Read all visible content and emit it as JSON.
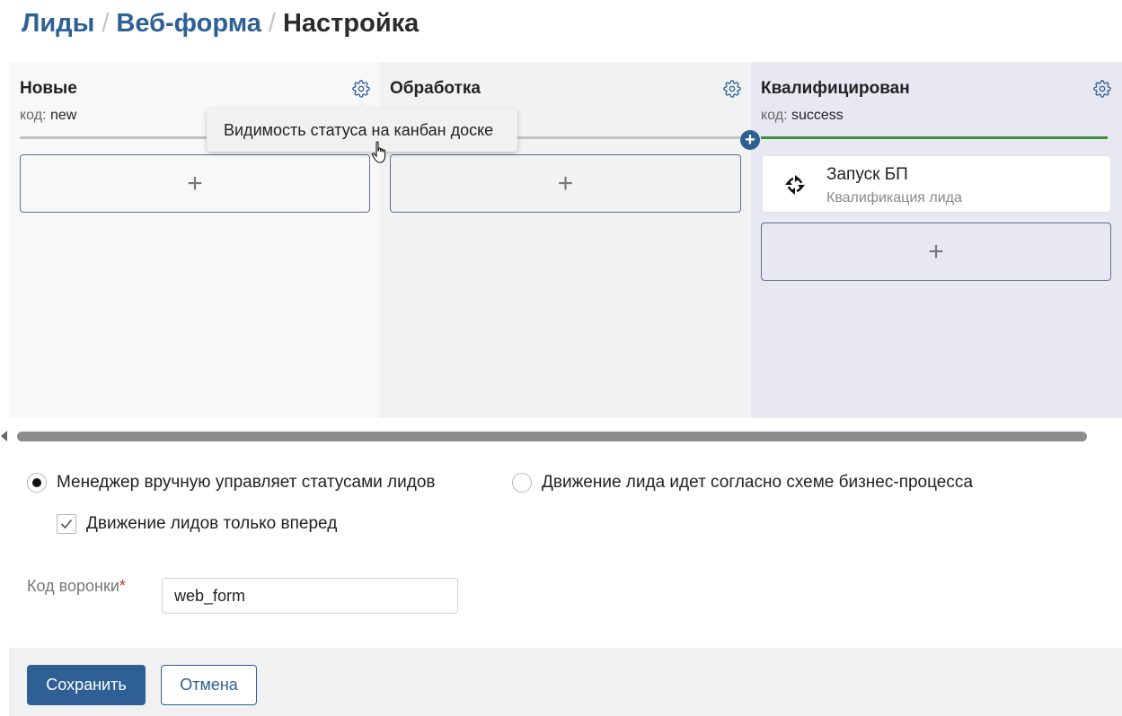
{
  "breadcrumb": {
    "items": [
      "Лиды",
      "Веб-форма"
    ],
    "current": "Настройка",
    "separator": "/"
  },
  "columns": [
    {
      "title": "Новые",
      "code_label": "код:",
      "code": "new",
      "add_label": "+",
      "background": "#f8f8f8",
      "line_color": "#c3c3c3"
    },
    {
      "title": "Обработка",
      "code_label": "код:",
      "code": "",
      "add_label": "+",
      "background": "#f2f2f2",
      "line_color": "#c3c3c3"
    },
    {
      "title": "Квалифицирован",
      "code_label": "код:",
      "code": "success",
      "add_label": "+",
      "background": "#e8e8f3",
      "line_color": "#3e9138"
    }
  ],
  "tooltip": {
    "text": "Видимость статуса на канбан доске"
  },
  "insert_status_label": "+",
  "process_card": {
    "title": "Запуск БП",
    "subtitle": "Квалификация лида",
    "icon": "process-cycle-icon"
  },
  "modes": {
    "manual": {
      "label": "Менеджер вручную управляет статусами лидов",
      "checked": true
    },
    "process": {
      "label": "Движение лида идет согласно схеме бизнес-процесса",
      "checked": false
    },
    "forward_only": {
      "label": "Движение лидов только вперед",
      "checked": true
    }
  },
  "funnel_code": {
    "label": "Код воронки",
    "required_mark": "*",
    "value": "web_form"
  },
  "buttons": {
    "save": "Сохранить",
    "cancel": "Отмена"
  },
  "colors": {
    "accent": "#2e6095",
    "success": "#3e9138",
    "required": "#cc2b2b"
  }
}
